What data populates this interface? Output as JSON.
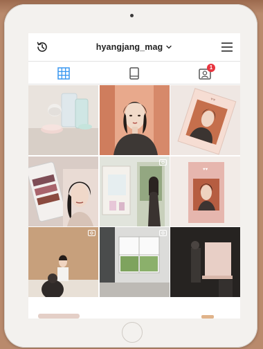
{
  "header": {
    "username": "hyangjang_mag",
    "username_caret": "chevron-down-icon",
    "history_icon": "history-icon",
    "menu_icon": "hamburger-menu-icon"
  },
  "tabs": [
    {
      "name": "grid",
      "icon": "grid-icon",
      "active": true
    },
    {
      "name": "igtv",
      "icon": "igtv-icon",
      "active": false
    },
    {
      "name": "tagged",
      "icon": "tagged-icon",
      "active": false,
      "badge": "1"
    }
  ],
  "posts": [
    {
      "subject": "cosmetics products on table",
      "video": false
    },
    {
      "subject": "portrait of woman",
      "video": false
    },
    {
      "subject": "magazine cover on pink background",
      "video": false
    },
    {
      "subject": "woman with makeup products",
      "video": false
    },
    {
      "subject": "woman in doorway",
      "video": true
    },
    {
      "subject": "pink magazine with portrait",
      "video": false
    },
    {
      "subject": "behind the scenes photo shoot",
      "video": true
    },
    {
      "subject": "room with windows",
      "video": true
    },
    {
      "subject": "dark studio setup",
      "video": false
    }
  ],
  "colors": {
    "accent_blue": "#3897f0",
    "badge_red": "#e8353f",
    "text_dark": "#222222"
  }
}
